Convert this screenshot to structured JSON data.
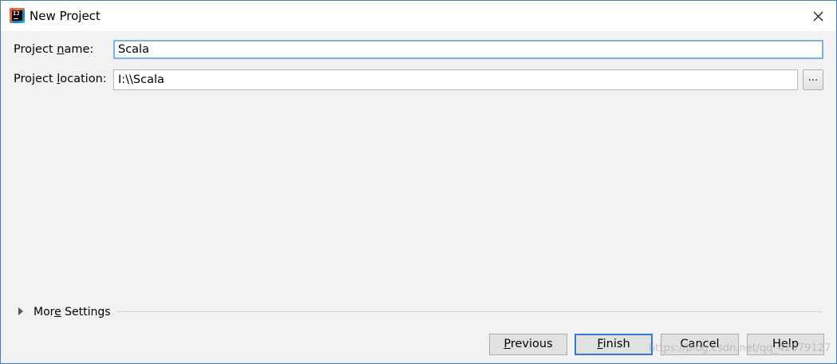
{
  "window": {
    "title": "New Project",
    "app_icon": "intellij-idea-icon",
    "close_icon": "close-icon"
  },
  "form": {
    "project_name_label_pre": "Project ",
    "project_name_label_mn": "n",
    "project_name_label_post": "ame:",
    "project_name_value": "Scala",
    "project_location_label_pre": "Project ",
    "project_location_label_mn": "l",
    "project_location_label_post": "ocation:",
    "project_location_value": "I:\\\\Scala",
    "browse_label": "..."
  },
  "more_settings": {
    "label_pre": "Mor",
    "label_mn": "e",
    "label_post": " Settings",
    "expanded": false
  },
  "buttons": {
    "previous_mn": "P",
    "previous_rest": "revious",
    "finish_mn": "F",
    "finish_rest": "inish",
    "cancel": "Cancel",
    "help": "Help"
  },
  "watermark": "https://blog.csdn.net/qq_42079127",
  "colors": {
    "window_border": "#3a7fc8",
    "default_button_border": "#2f7bd6",
    "focus_field_border": "#7bb3e8"
  }
}
